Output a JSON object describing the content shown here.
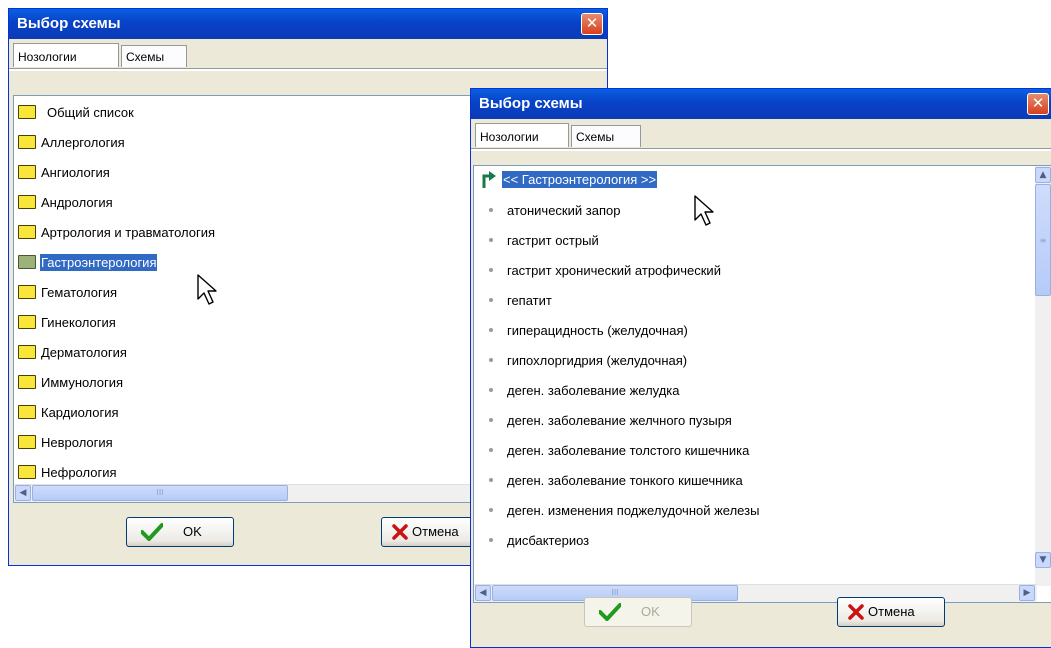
{
  "window1": {
    "title": "Выбор схемы",
    "close_label": "✕",
    "tabs": [
      "Нозологии",
      "Схемы"
    ],
    "items": [
      {
        "label": "Общий список",
        "selected": false
      },
      {
        "label": "Аллергология",
        "selected": false
      },
      {
        "label": "Ангиология",
        "selected": false
      },
      {
        "label": "Андрология",
        "selected": false
      },
      {
        "label": "Артрология и травматология",
        "selected": false
      },
      {
        "label": "Гастроэнтерология",
        "selected": true
      },
      {
        "label": "Гематология",
        "selected": false
      },
      {
        "label": "Гинекология",
        "selected": false
      },
      {
        "label": "Дерматология",
        "selected": false
      },
      {
        "label": "Иммунология",
        "selected": false
      },
      {
        "label": "Кардиология",
        "selected": false
      },
      {
        "label": "Неврология",
        "selected": false
      },
      {
        "label": "Нефрология",
        "selected": false
      }
    ],
    "hscroll_grip": "III",
    "ok_label": "OK",
    "cancel_label": "Отмена"
  },
  "window2": {
    "title": "Выбор схемы",
    "close_label": "✕",
    "tabs": [
      "Нозологии",
      "Схемы"
    ],
    "back_item": "<< Гастроэнтерология >>",
    "items": [
      "атонический запор",
      "гастрит острый",
      "гастрит хронический атрофический",
      "гепатит",
      "гиперацидность (желудочная)",
      "гипохлоргидрия (желудочная)",
      "деген. заболевание желудка",
      "деген. заболевание желчного пузыря",
      "деген. заболевание толстого кишечника",
      "деген. заболевание тонкого кишечника",
      "деген. изменения поджелудочной железы",
      "дисбактериоз"
    ],
    "hscroll_grip": "III",
    "vscroll_grip": "≡",
    "ok_label": "OK",
    "ok_disabled": true,
    "cancel_label": "Отмена"
  },
  "colors": {
    "titlebar": "#0842c8",
    "selection": "#316ac5",
    "folder": "#f8e63a",
    "ok_check": "#1f9a1f",
    "cancel_x": "#cc1111"
  },
  "icons": [
    "folder-icon",
    "close-icon",
    "check-icon",
    "cancel-x-icon",
    "back-arrow-icon",
    "bullet-icon",
    "cursor-icon"
  ]
}
